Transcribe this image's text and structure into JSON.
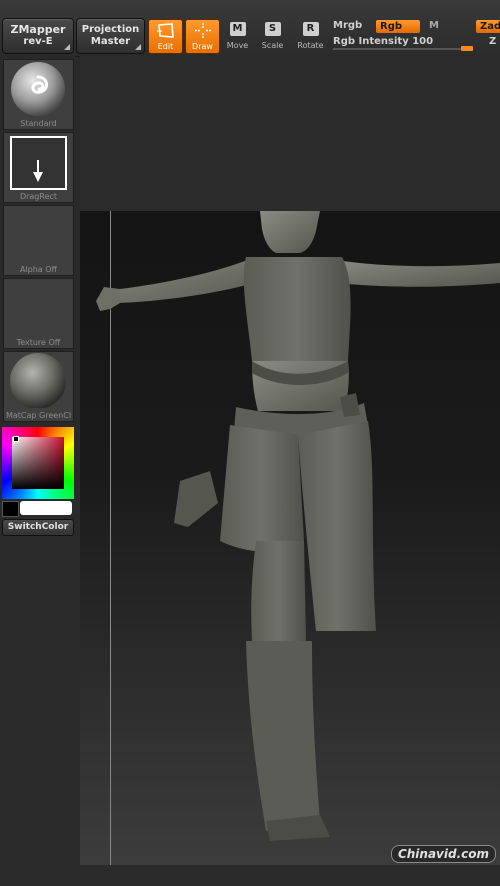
{
  "topbar": {
    "zmapper": {
      "line1": "ZMapper",
      "line2": "rev-E"
    },
    "projection": {
      "line1": "Projection",
      "line2": "Master"
    },
    "tools": [
      {
        "label": "Edit",
        "active": true,
        "icon": "edit-icon"
      },
      {
        "label": "Draw",
        "active": true,
        "icon": "draw-icon"
      },
      {
        "label": "Move",
        "active": false,
        "key": "M"
      },
      {
        "label": "Scale",
        "active": false,
        "key": "S"
      },
      {
        "label": "Rotate",
        "active": false,
        "key": "R"
      }
    ],
    "mrgb": "Mrgb",
    "rgb": "Rgb",
    "m": "M",
    "rgb_intensity": {
      "label": "Rgb",
      "name": "Intensity",
      "value": 100
    },
    "zadd": "Zadd",
    "z": "Z",
    "accent": "#f07a10"
  },
  "shelf": {
    "slots": [
      {
        "label": "Standard",
        "icon": "brush-standard-icon"
      },
      {
        "label": "DragRect",
        "icon": "dragrect-stroke-icon"
      },
      {
        "label": "Alpha  Off",
        "icon": ""
      },
      {
        "label": "Texture  Off",
        "icon": ""
      },
      {
        "label": "MatCap  GreenCl",
        "icon": "matcap-sphere-icon"
      }
    ],
    "switch_color": "SwitchColor"
  },
  "watermark": "Chinavid.com"
}
